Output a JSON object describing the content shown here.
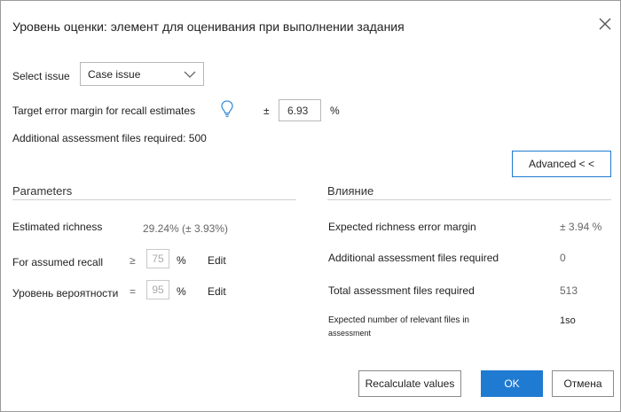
{
  "dialog": {
    "title": "Уровень оценки: элемент для оценивания при выполнении задания"
  },
  "issue": {
    "label": "Select issue",
    "selected": "Case issue"
  },
  "target": {
    "label": "Target error margin for recall estimates",
    "pm": "±",
    "value": "6.93",
    "unit": "%"
  },
  "additional_files": "Additional assessment files required: 500",
  "advanced_label": "Advanced < <",
  "parameters": {
    "title": "Parameters",
    "richness_label": "Estimated richness",
    "richness_value": "29.24% (± 3.93%)",
    "recall_label": "For assumed recall",
    "recall_op": "≥",
    "recall_value": "75",
    "recall_unit": "%",
    "recall_edit": "Edit",
    "confidence_label": "Уровень вероятности",
    "confidence_op": "=",
    "confidence_value": "95",
    "confidence_unit": "%",
    "confidence_edit": "Edit"
  },
  "impact": {
    "title": "Влияние",
    "rows": [
      {
        "label": "Expected richness error margin",
        "value": "± 3.94 %"
      },
      {
        "label": "Additional assessment files required",
        "value": "0"
      },
      {
        "label": "Total assessment files required",
        "value": "513"
      }
    ],
    "relevant_label_line1": "Expected number of relevant files in",
    "relevant_label_line2": "assessment",
    "relevant_value": "1so"
  },
  "buttons": {
    "recalculate": "Recalculate values",
    "ok": "OK",
    "cancel": "Отмена"
  },
  "colors": {
    "accent": "#1f7ad1",
    "bulb": "#3a8fd8"
  },
  "icons": {
    "close": "close-icon",
    "dropdown": "chevron-down-icon",
    "tip": "lightbulb-icon"
  }
}
